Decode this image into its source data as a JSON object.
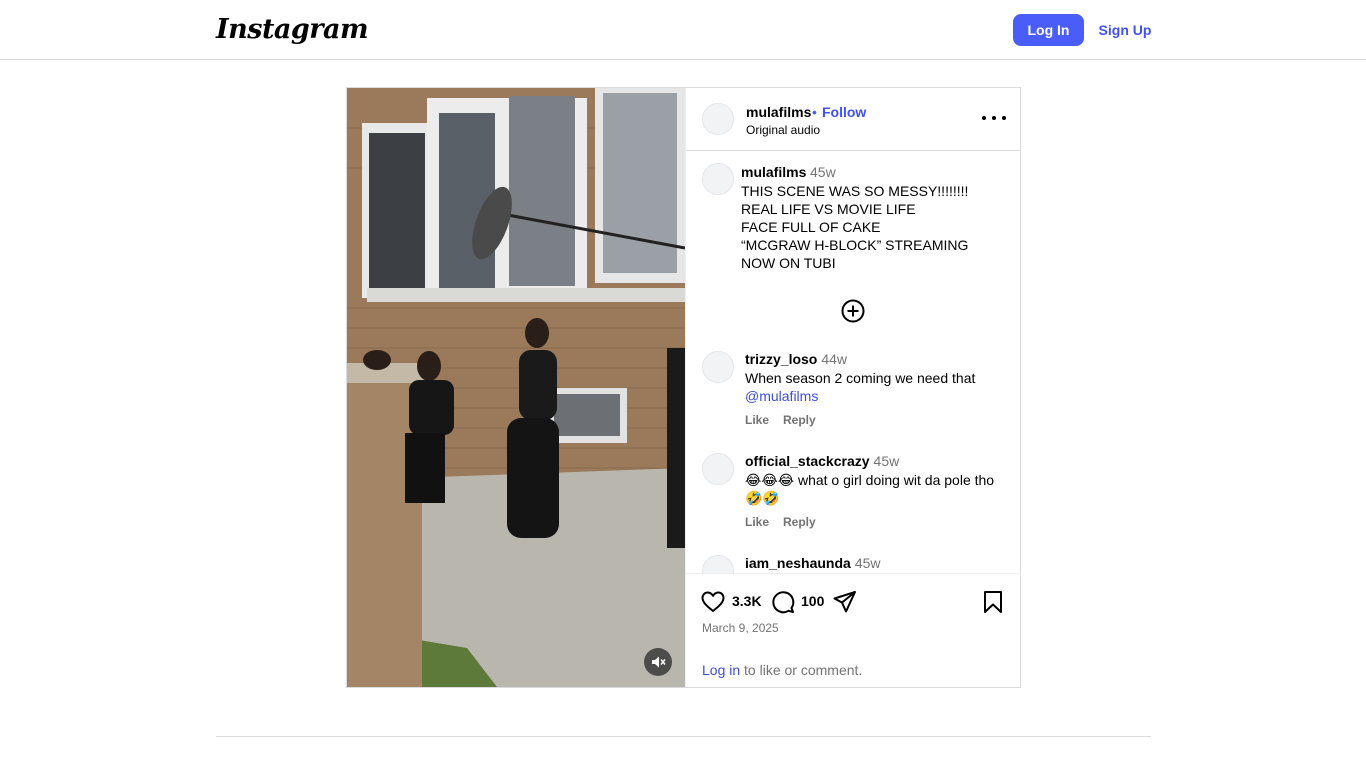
{
  "header": {
    "logo": "Instagram",
    "login_label": "Log In",
    "signup_label": "Sign Up"
  },
  "post": {
    "username": "mulafilms",
    "dot": "•",
    "follow_label": "Follow",
    "audio": "Original audio",
    "caption": {
      "username": "mulafilms",
      "time": "45w",
      "text": "THIS SCENE WAS SO MESSY!!!!!!!!\nREAL LIFE VS MOVIE LIFE\nFACE FULL OF CAKE\n“MCGRAW H-BLOCK” STREAMING NOW ON TUBI"
    },
    "comments": [
      {
        "username": "trizzy_loso",
        "time": "44w",
        "text": "When season 2 coming we need that ",
        "mention": "@mulafilms",
        "like": "Like",
        "reply": "Reply"
      },
      {
        "username": "official_stackcrazy",
        "time": "45w",
        "text": "😂😂😂 what o girl doing wit da pole tho 🤣🤣",
        "mention": "",
        "like": "Like",
        "reply": "Reply"
      },
      {
        "username": "iam_neshaunda",
        "time": "45w",
        "text": "",
        "mention": "",
        "like": "",
        "reply": ""
      }
    ],
    "likes": "3.3K",
    "comment_count": "100",
    "date": "March 9, 2025",
    "login_link": "Log in",
    "login_suffix": " to like or comment."
  },
  "icons": {
    "more": "more-options-icon",
    "load_more": "plus-circle-icon",
    "like": "heart-icon",
    "comment": "comment-bubble-icon",
    "share": "paper-plane-icon",
    "save": "bookmark-icon",
    "mute": "speaker-muted-icon"
  },
  "colors": {
    "brand_blue": "#4a5df9",
    "link_blue": "#4150f7",
    "muted_text": "#737373",
    "border": "#dbdbdb"
  }
}
